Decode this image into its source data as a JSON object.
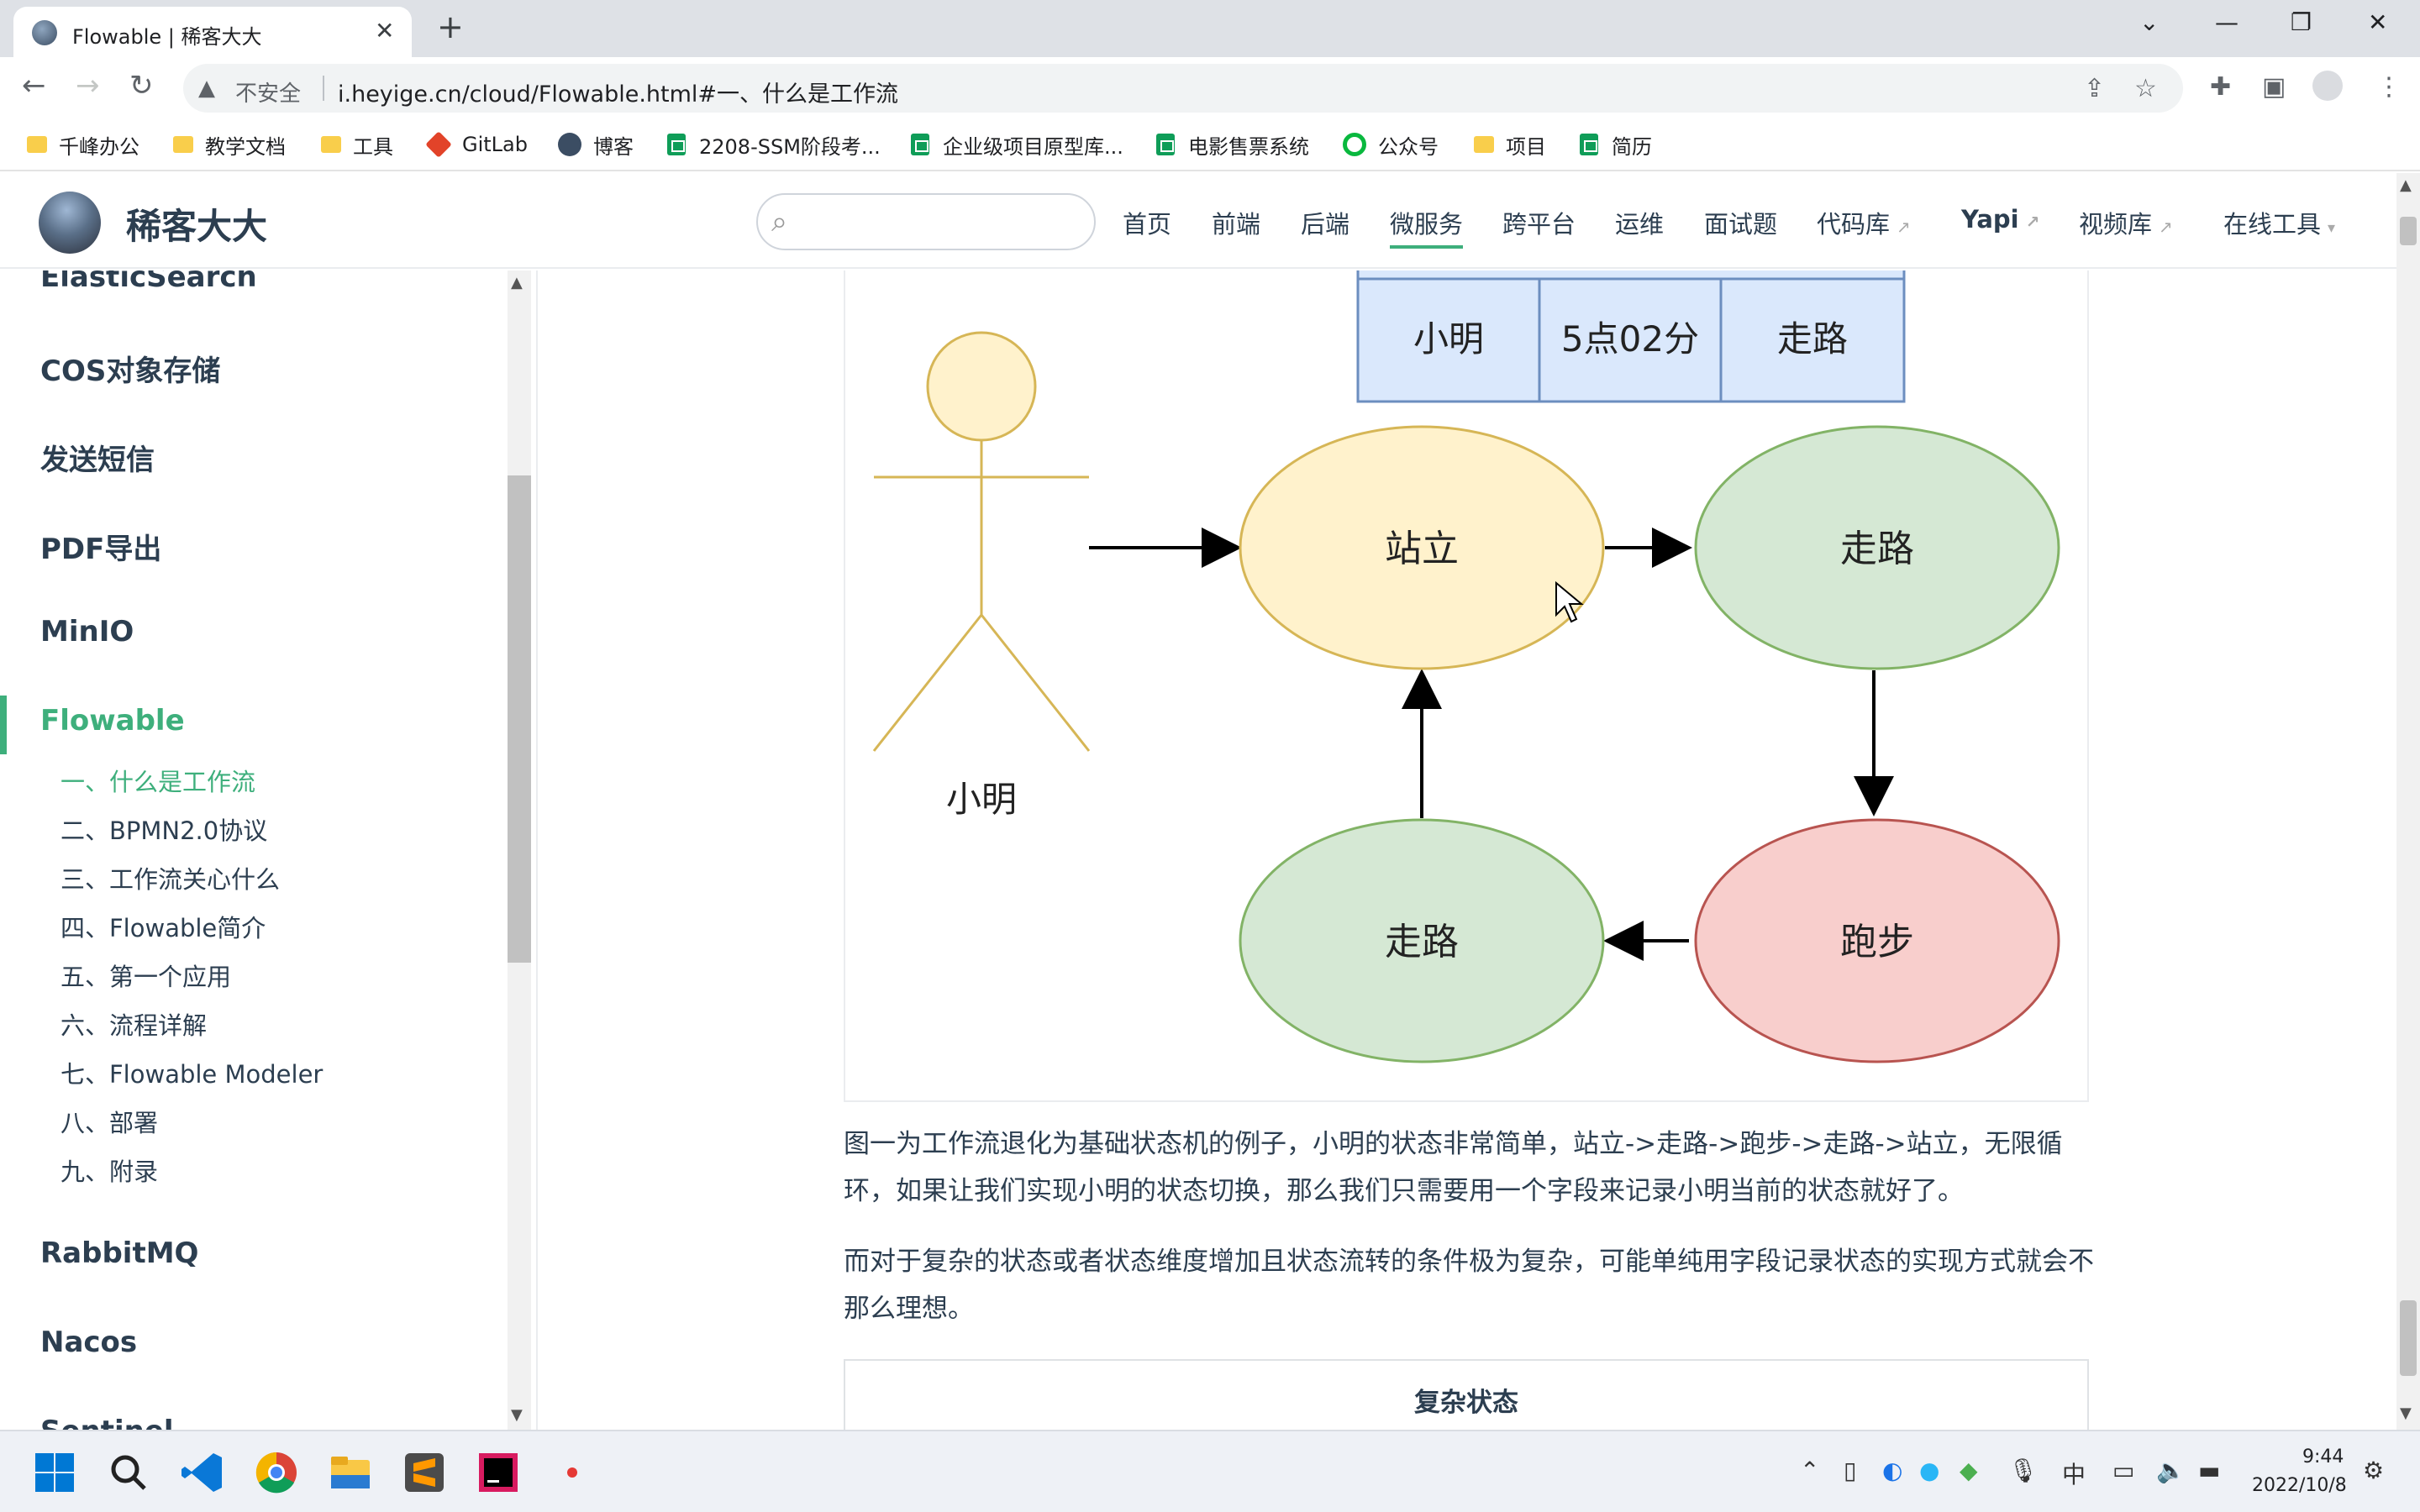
{
  "browser": {
    "tab_title": "Flowable | 稀客大大",
    "tab_close": "✕",
    "new_tab": "+",
    "insecure_label": "不安全",
    "url": "i.heyige.cn/cloud/Flowable.html#一、什么是工作流",
    "window_controls": {
      "minimize": "—",
      "restore": "❐",
      "close": "✕",
      "dropdown": "⌄"
    }
  },
  "bookmarks": [
    {
      "label": "千峰办公",
      "icon": "folder"
    },
    {
      "label": "教学文档",
      "icon": "folder"
    },
    {
      "label": "工具",
      "icon": "folder"
    },
    {
      "label": "GitLab",
      "icon": "gitlab"
    },
    {
      "label": "博客",
      "icon": "avatar"
    },
    {
      "label": "2208-SSM阶段考...",
      "icon": "sheet"
    },
    {
      "label": "企业级项目原型库...",
      "icon": "sheet"
    },
    {
      "label": "电影售票系统",
      "icon": "sheet"
    },
    {
      "label": "公众号",
      "icon": "refresh"
    },
    {
      "label": "项目",
      "icon": "folder"
    },
    {
      "label": "简历",
      "icon": "sheet"
    }
  ],
  "site": {
    "name": "稀客大大",
    "nav": [
      "首页",
      "前端",
      "后端",
      "微服务",
      "跨平台",
      "运维",
      "面试题",
      "代码库",
      "Yapi",
      "视频库",
      "在线工具"
    ],
    "nav_active": "微服务"
  },
  "sidebar": {
    "headers": [
      "ElasticSearch",
      "COS对象存储",
      "发送短信",
      "PDF导出",
      "MinIO",
      "Flowable",
      "RabbitMQ",
      "Nacos",
      "Sentinel"
    ],
    "active_header": "Flowable",
    "subitems": [
      "一、什么是工作流",
      "二、BPMN2.0协议",
      "三、工作流关心什么",
      "四、Flowable简介",
      "五、第一个应用",
      "六、流程详解",
      "七、Flowable Modeler",
      "八、部署",
      "九、附录"
    ],
    "active_subitem": "一、什么是工作流"
  },
  "diagram": {
    "table_cells": [
      "小明",
      "5点02分",
      "走路"
    ],
    "actor_label": "小明",
    "nodes": {
      "stand": "站立",
      "walk1": "走路",
      "run": "跑步",
      "walk2": "走路"
    },
    "colors": {
      "yellow_fill": "#fff2cc",
      "yellow_stroke": "#d6b656",
      "green_fill": "#d5e8d4",
      "green_stroke": "#82b366",
      "red_fill": "#f8cecc",
      "red_stroke": "#b85450",
      "blue_fill": "#dae8fc",
      "blue_stroke": "#6c8ebf"
    }
  },
  "content": {
    "para1": "图一为工作流退化为基础状态机的例子，小明的状态非常简单，站立->走路->跑步->走路->站立，无限循环，如果让我们实现小明的状态切换，那么我们只需要用一个字段来记录小明当前的状态就好了。",
    "para2": "而对于复杂的状态或者状态维度增加且状态流转的条件极为复杂，可能单纯用字段记录状态的实现方式就会不那么理想。",
    "table_title": "复杂状态"
  },
  "taskbar": {
    "ime": "中",
    "time": "9:44",
    "date": "2022/10/8"
  }
}
